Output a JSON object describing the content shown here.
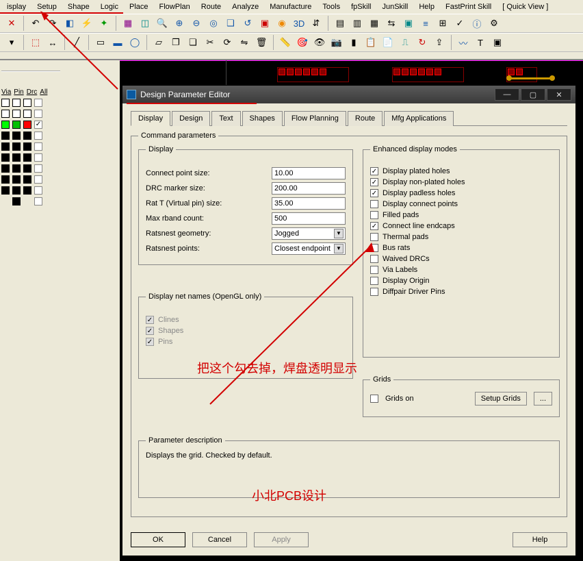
{
  "menu": {
    "items": [
      "isplay",
      "Setup",
      "Shape",
      "Logic",
      "Place",
      "FlowPlan",
      "Route",
      "Analyze",
      "Manufacture",
      "Tools",
      "fpSkill",
      "JunSkill",
      "Help",
      "FastPrint Skill",
      "[ Quick View ]"
    ]
  },
  "left_panel": {
    "headers": [
      "Via",
      "Pin",
      "Drc",
      "All"
    ]
  },
  "dialog": {
    "title": "Design Parameter Editor",
    "tabs": [
      "Display",
      "Design",
      "Text",
      "Shapes",
      "Flow Planning",
      "Route",
      "Mfg Applications"
    ],
    "active_tab": "Display",
    "group_command": "Command parameters",
    "group_display": "Display",
    "group_enhanced": "Enhanced display modes",
    "group_netnames": "Display net names (OpenGL only)",
    "group_grids": "Grids",
    "group_paramdesc": "Parameter description",
    "display_fields": {
      "connect_point_size": {
        "label": "Connect point size:",
        "value": "10.00"
      },
      "drc_marker_size": {
        "label": "DRC marker size:",
        "value": "200.00"
      },
      "rat_t_size": {
        "label": "Rat T (Virtual pin) size:",
        "value": "35.00"
      },
      "max_rband_count": {
        "label": "Max rband count:",
        "value": "500"
      },
      "ratsnest_geometry": {
        "label": "Ratsnest geometry:",
        "value": "Jogged"
      },
      "ratsnest_points": {
        "label": "Ratsnest points:",
        "value": "Closest endpoint"
      }
    },
    "enhanced": [
      {
        "label": "Display plated holes",
        "checked": true
      },
      {
        "label": "Display non-plated holes",
        "checked": true
      },
      {
        "label": "Display padless holes",
        "checked": true
      },
      {
        "label": "Display connect points",
        "checked": false
      },
      {
        "label": "Filled pads",
        "checked": false
      },
      {
        "label": "Connect line endcaps",
        "checked": true
      },
      {
        "label": "Thermal pads",
        "checked": false
      },
      {
        "label": "Bus rats",
        "checked": false
      },
      {
        "label": "Waived DRCs",
        "checked": false
      },
      {
        "label": "Via Labels",
        "checked": false
      },
      {
        "label": "Display Origin",
        "checked": false
      },
      {
        "label": "Diffpair Driver Pins",
        "checked": false
      }
    ],
    "netnames": [
      {
        "label": "Clines",
        "checked": true
      },
      {
        "label": "Shapes",
        "checked": true
      },
      {
        "label": "Pins",
        "checked": true
      }
    ],
    "grids": {
      "grids_on_label": "Grids on",
      "grids_on_checked": false,
      "setup_button": "Setup Grids",
      "ellipsis": "..."
    },
    "param_desc": "Displays the grid. Checked by default.",
    "buttons": {
      "ok": "OK",
      "cancel": "Cancel",
      "apply": "Apply",
      "help": "Help"
    }
  },
  "annotations": {
    "uncheck_hint": "把这个勾去掉，焊盘透明显示",
    "watermark": "小北PCB设计"
  }
}
